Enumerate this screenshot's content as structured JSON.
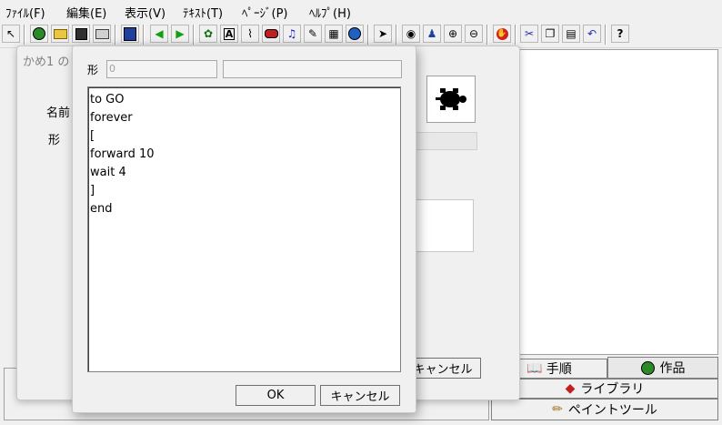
{
  "menu": [
    "ﾌｧｲﾙ(F)",
    "編集(E)",
    "表示(V)",
    "ﾃｷｽﾄ(T)",
    "ﾍﾟｰｼﾞ(P)",
    "ﾍﾙﾌﾟ(H)"
  ],
  "toolbar_icons": [
    "select-tool-icon",
    "globe-icon",
    "open-folder-icon",
    "save-icon",
    "print-icon",
    "page-view-icon",
    "back-arrow-icon",
    "forward-arrow-icon",
    "turtle-icon",
    "text-box-icon",
    "paint-brush-icon",
    "record-icon",
    "music-note-icon",
    "pen-icon",
    "projector-icon",
    "net-globe-icon",
    "pointer-icon",
    "eye-icon",
    "stamp-icon",
    "zoom-in-icon",
    "zoom-out-icon",
    "stop-hand-icon",
    "scissors-icon",
    "copy-icon",
    "paste-icon",
    "undo-icon",
    "help-icon"
  ],
  "tabs": {
    "procedures": "手順",
    "projects": "作品",
    "library": "ライブラリ",
    "paint_tool": "ペイントツール"
  },
  "back_dialog": {
    "title": "かめ1 の",
    "name_label": "名前",
    "shape_label": "形",
    "cancel_label": "キャンセル"
  },
  "front_dialog": {
    "shape_label": "形",
    "shape_value": "0",
    "code_lines": [
      "to GO",
      "forever",
      "[",
      "forward 10",
      "wait 4",
      "]",
      "end"
    ],
    "ok_label": "OK",
    "cancel_label": "キャンセル"
  }
}
